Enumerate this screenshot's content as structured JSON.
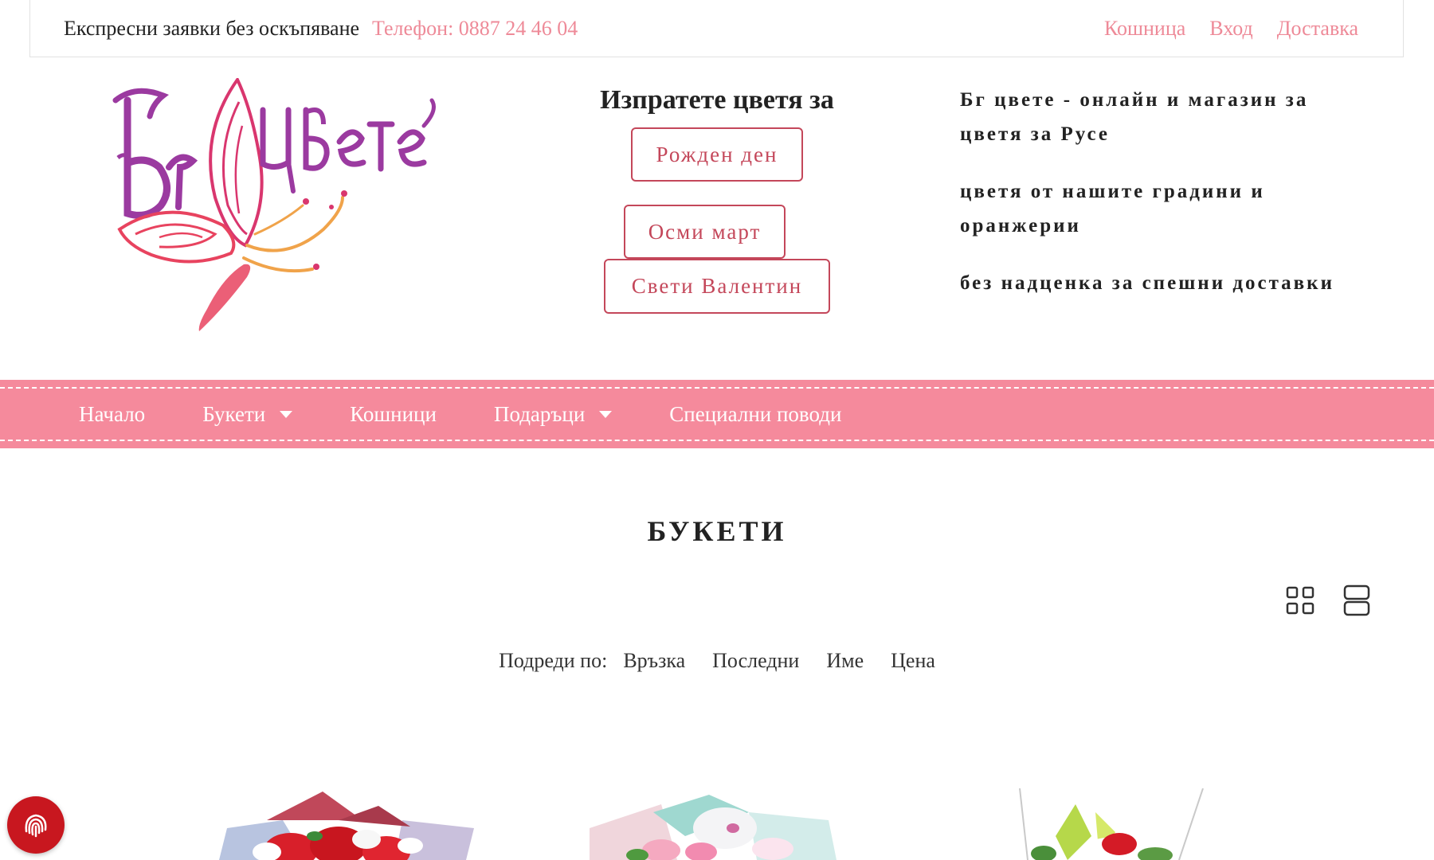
{
  "topbar": {
    "tagline": "Експресни заявки без оскъпяване",
    "phone": "Телефон: 0887 24 46 04",
    "links": {
      "cart": "Кошница",
      "login": "Вход",
      "delivery": "Доставка"
    }
  },
  "header": {
    "logo_text": "Бг цвете",
    "occasions_title": "Изпратете цветя за",
    "occasions": {
      "birthday": "Рожден ден",
      "march8": "Осми март",
      "valentine": "Свети Валентин"
    },
    "promo": [
      "Бг цвете - онлайн и магазин за цветя за Русе",
      "цветя от нашите градини и оранжерии",
      "без надценка за спешни доставки"
    ]
  },
  "nav": {
    "home": "Начало",
    "bouquets": "Букети",
    "baskets": "Кошници",
    "gifts": "Подаръци",
    "special": "Специални поводи"
  },
  "page": {
    "title": "БУКЕТИ",
    "sort_label": "Подреди по:",
    "sort_options": {
      "relation": "Връзка",
      "latest": "Последни",
      "name": "Име",
      "price": "Цена"
    }
  },
  "icons": {
    "view_grid": "grid-view-icon",
    "view_list": "list-view-icon",
    "fingerprint": "fingerprint-icon",
    "caret": "chevron-down-icon"
  },
  "colors": {
    "accent_pink": "#f58a9c",
    "link_pink": "#ee8a98",
    "button_red": "#c4475a",
    "badge_red": "#c8171f",
    "logo_purple": "#9b3aa0",
    "logo_magenta": "#d9366e",
    "logo_orange": "#f0a34a"
  }
}
